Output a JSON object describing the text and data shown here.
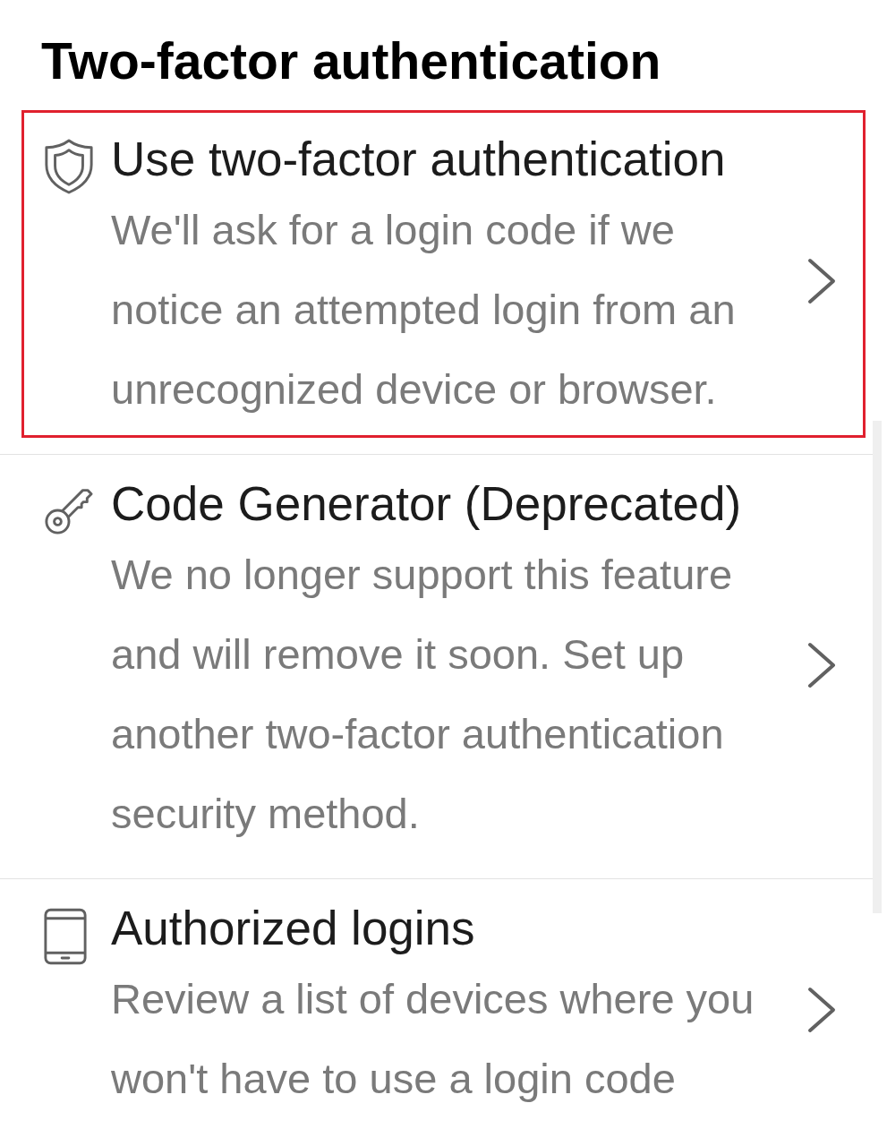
{
  "header": {
    "title": "Two-factor authentication"
  },
  "items": [
    {
      "title": "Use two-factor authentication",
      "description": "We'll ask for a login code if we notice an attempted login from an unrecognized device or browser.",
      "highlighted": true
    },
    {
      "title": "Code Generator (Deprecated)",
      "description": "We no longer support this feature and will remove it soon. Set up another two-factor authentication security method.",
      "highlighted": false
    },
    {
      "title": "Authorized logins",
      "description": "Review a list of devices where you won't have to use a login code",
      "highlighted": false
    }
  ]
}
